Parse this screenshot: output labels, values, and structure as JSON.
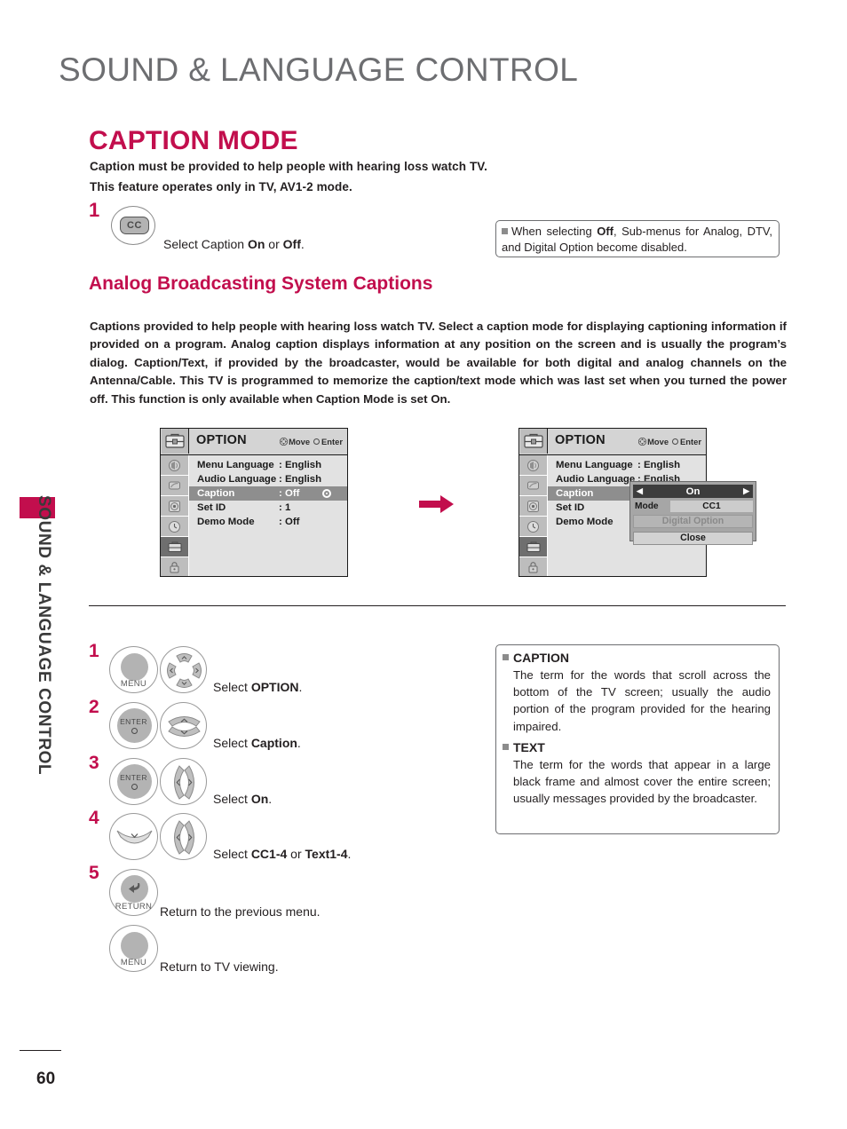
{
  "sidetab": {
    "label": "SOUND & LANGUAGE CONTROL",
    "color": "#C20E4D"
  },
  "header": {
    "title": "SOUND & LANGUAGE CONTROL"
  },
  "section": {
    "title": "CAPTION MODE",
    "intro_line1": "Caption must be provided to help people with hearing loss watch TV.",
    "intro_line2": "This feature operates only in TV, AV1-2 mode."
  },
  "step_cc": {
    "number": "1",
    "key_label": "CC",
    "text_prefix": "Select Caption ",
    "bold_on": "On",
    "text_mid": " or ",
    "bold_off": "Off",
    "text_suffix": "."
  },
  "note": {
    "text_a": "When selecting ",
    "bold": "Off",
    "text_b": ", Sub-menus for Analog, DTV, and Digital Option become disabled."
  },
  "subheading": "Analog Broadcasting System Captions",
  "paragraph": {
    "part_a": "Captions provided to help people with hearing loss watch TV. Select a caption mode for displaying captioning information if provided on a program. Analog caption displays information at any position on the screen and is usually the program’s dialog. Caption/Text, if provided by the broadcaster, would be available for both digital and analog channels on the Antenna/Cable. This TV is programmed to memorize the caption/text mode which was last set when you turned the power off. This function is only available when ",
    "bold_1": "Caption",
    "part_b": " Mode is set ",
    "bold_2": "On",
    "part_c": "."
  },
  "osd": {
    "title": "OPTION",
    "hint_move": "Move",
    "hint_enter": "Enter",
    "rail_icons": [
      "picture-icon",
      "screen-icon",
      "audio-icon",
      "time-icon",
      "option-icon",
      "lock-icon"
    ],
    "rail_active_index": 4,
    "left": {
      "rows": [
        {
          "label": "Menu Language",
          "value": ": English",
          "selected": false
        },
        {
          "label": "Audio Language",
          "value": ": English",
          "selected": false
        },
        {
          "label": "Caption",
          "value": ": Off",
          "selected": true
        },
        {
          "label": "Set ID",
          "value": ": 1",
          "selected": false
        },
        {
          "label": "Demo Mode",
          "value": ": Off",
          "selected": false
        }
      ]
    },
    "right": {
      "rows": [
        {
          "label": "Menu Language",
          "value": ": English",
          "selected": false
        },
        {
          "label": "Audio Language",
          "value": ": English",
          "selected": false
        },
        {
          "label": "Caption",
          "value": "",
          "selected": true
        },
        {
          "label": "Set ID",
          "value": "",
          "selected": false
        },
        {
          "label": "Demo Mode",
          "value": "",
          "selected": false
        }
      ],
      "popup": {
        "state": "On",
        "left_arrow": "◀",
        "right_arrow": "▶",
        "mode_label": "Mode",
        "mode_value": "CC1",
        "digital_option": "Digital Option",
        "close": "Close"
      }
    }
  },
  "steps": [
    {
      "number": "1",
      "keys": [
        "MENU",
        "dpad-4way"
      ],
      "text_prefix": "Select ",
      "bold": "OPTION",
      "text_suffix": "."
    },
    {
      "number": "2",
      "keys": [
        "ENTER",
        "updown"
      ],
      "text_prefix": "Select ",
      "bold": "Caption",
      "text_suffix": "."
    },
    {
      "number": "3",
      "keys": [
        "ENTER",
        "leftright"
      ],
      "text_prefix": "Select ",
      "bold": "On",
      "text_suffix": "."
    },
    {
      "number": "4",
      "keys": [
        "down",
        "leftright"
      ],
      "text_prefix": "Select ",
      "bold": "CC1-4",
      "text_mid": " or ",
      "bold2": "Text1-4",
      "text_suffix": "."
    },
    {
      "number": "5",
      "keys": [
        "RETURN"
      ],
      "text_prefix": "Return to the previous menu.",
      "bold": "",
      "text_suffix": ""
    }
  ],
  "step_menu_return": {
    "key_label": "MENU",
    "text": "Return to TV viewing."
  },
  "info_box": {
    "caption_head": "CAPTION",
    "caption_body": "The term for the words that scroll across the bottom of the TV screen; usually the audio portion of the program provided for the hearing impaired.",
    "text_head": "TEXT",
    "text_body": "The term for the words that appear in a large black frame and almost cover the entire screen; usually messages provided by the broadcaster."
  },
  "footer": {
    "page_number": "60"
  }
}
